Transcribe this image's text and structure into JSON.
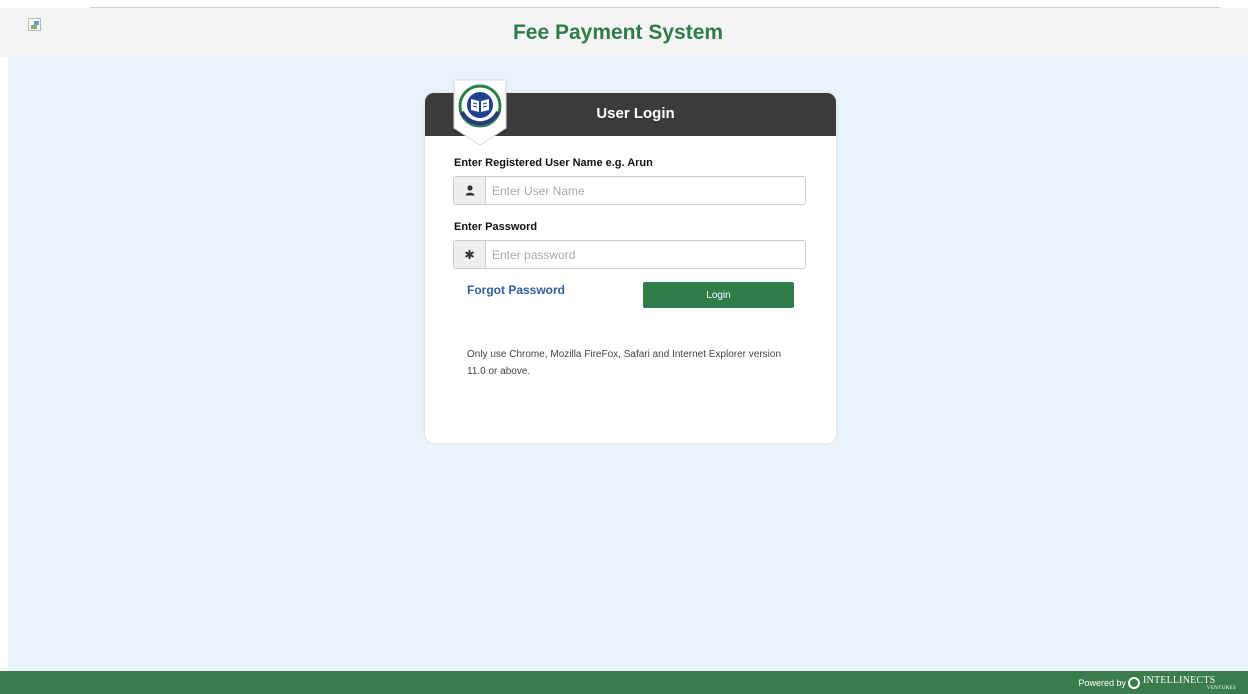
{
  "header": {
    "title": "Fee Payment System"
  },
  "login": {
    "title": "User Login",
    "username_label": "Enter Registered User Name e.g. Arun",
    "username_placeholder": "Enter User Name",
    "username_icon": "user-icon",
    "password_label": "Enter Password",
    "password_placeholder": "Enter password",
    "password_icon": "asterisk-icon",
    "forgot_label": "Forgot Password",
    "login_label": "Login",
    "note": "Only use Chrome, Mozilla FireFox, Safari and Internet Explorer version 11.0 or above."
  },
  "footer": {
    "powered_label": "Powered by",
    "brand_name": "INTELLINECTS",
    "brand_sub": "VENTURES"
  },
  "colors": {
    "brand_green": "#2e7d48",
    "footer_green": "#3a7d4a",
    "card_header": "#3b3b3b",
    "link_blue": "#2b5f9e",
    "page_bg": "#e9f4fa"
  }
}
